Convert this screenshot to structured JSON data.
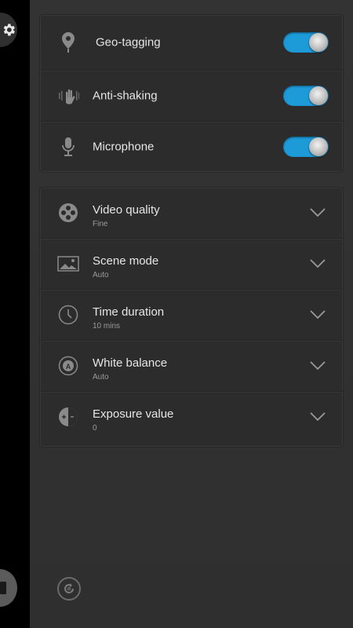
{
  "toggles": [
    {
      "label": "Geo-tagging",
      "icon": "location-pin-icon",
      "on": true
    },
    {
      "label": "Anti-shaking",
      "icon": "hand-shake-icon",
      "on": true
    },
    {
      "label": "Microphone",
      "icon": "microphone-icon",
      "on": true
    }
  ],
  "options": [
    {
      "label": "Video quality",
      "value": "Fine",
      "icon": "film-reel-icon"
    },
    {
      "label": "Scene mode",
      "value": "Auto",
      "icon": "landscape-icon"
    },
    {
      "label": "Time duration",
      "value": "10 mins",
      "icon": "clock-icon"
    },
    {
      "label": "White balance",
      "value": "Auto",
      "icon": "white-balance-icon"
    },
    {
      "label": "Exposure value",
      "value": "0",
      "icon": "exposure-icon"
    }
  ],
  "colors": {
    "accent": "#1d9ad8",
    "panel": "#333333",
    "card": "#2c2c2c",
    "text": "#e6e6e6",
    "subtext": "#9a9a9a"
  }
}
